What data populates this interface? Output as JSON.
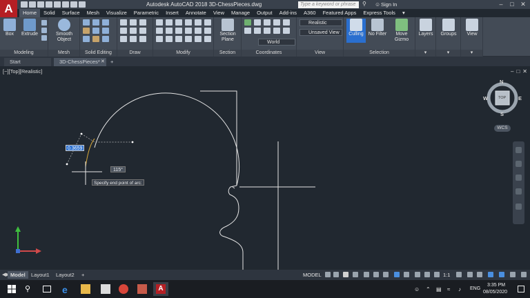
{
  "window": {
    "title": "Autodesk AutoCAD 2018   3D-ChessPieces.dwg",
    "search_placeholder": "Type a keyword or phrase",
    "sign_in": "Sign In"
  },
  "app_menu": {
    "letter": "A"
  },
  "ribbon_tabs": [
    "Home",
    "Solid",
    "Surface",
    "Mesh",
    "Visualize",
    "Parametric",
    "Insert",
    "Annotate",
    "View",
    "Manage",
    "Output",
    "Add-ins",
    "A360",
    "Featured Apps",
    "Express Tools"
  ],
  "ribbon": {
    "modeling": {
      "title": "Modeling",
      "box": "Box",
      "extrude": "Extrude"
    },
    "mesh": {
      "title": "Mesh",
      "smooth_object": "Smooth Object"
    },
    "solid_editing": {
      "title": "Solid Editing"
    },
    "draw": {
      "title": "Draw"
    },
    "modify": {
      "title": "Modify"
    },
    "section": {
      "title": "Section",
      "section_plane": "Section Plane"
    },
    "coordinates": {
      "title": "Coordinates",
      "ucs_value": "World"
    },
    "view": {
      "title": "View",
      "visual_style": "Realistic",
      "saved_view": "Unsaved View"
    },
    "selection": {
      "title": "Selection",
      "culling": "Culling",
      "no_filter": "No Filter",
      "move_gizmo": "Move Gizmo"
    },
    "layers": "Layers",
    "groups": "Groups",
    "view_btn": "View"
  },
  "file_tabs": {
    "start": "Start",
    "document": "3D-ChessPieces*",
    "add": "+"
  },
  "viewport": {
    "label": "[−][Top][Realistic]",
    "dim_input": "0.3659",
    "angle": "115°",
    "tooltip": "Specify end point of arc:"
  },
  "viewcube": {
    "north": "N",
    "south": "S",
    "east": "E",
    "west": "W",
    "face": "TOP",
    "wcs": "WCS"
  },
  "layout_tabs": {
    "model": "Model",
    "layout1": "Layout1",
    "layout2": "Layout2",
    "add": "+"
  },
  "status_bar": {
    "model": "MODEL",
    "scale": "1:1"
  },
  "taskbar": {
    "language": "ENG",
    "time": "3:35 PM",
    "date": "08/05/2020"
  },
  "colors": {
    "canvas": "#212830",
    "accent": "#2a6fcf",
    "logo": "#b51f24"
  }
}
